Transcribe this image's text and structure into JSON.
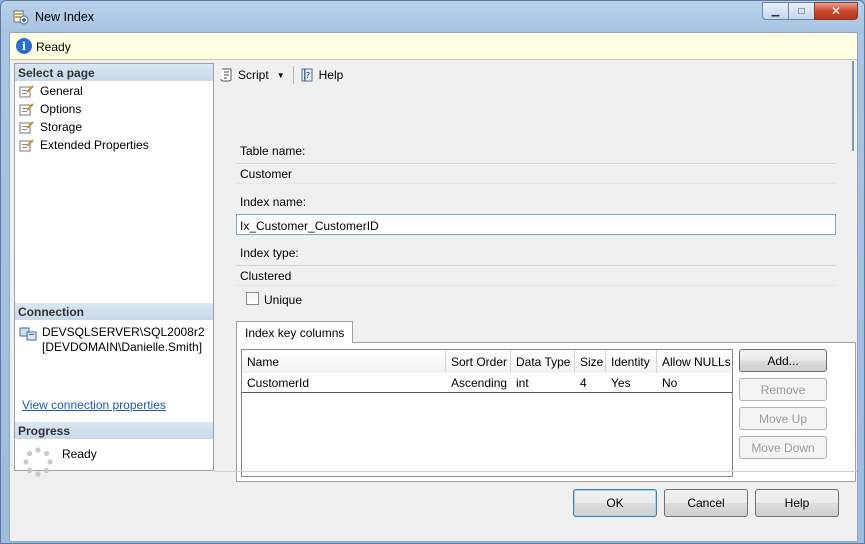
{
  "window": {
    "title": "New Index",
    "buttons": {
      "minimize": "▁",
      "maximize": "□",
      "close": "✕"
    }
  },
  "status": {
    "icon": "info-icon",
    "text": "Ready"
  },
  "sidebar": {
    "select_page_header": "Select a page",
    "pages": [
      "General",
      "Options",
      "Storage",
      "Extended Properties"
    ],
    "connection_header": "Connection",
    "connection_server": "DEVSQLSERVER\\SQL2008r2",
    "connection_user": "[DEVDOMAIN\\Danielle.Smith]",
    "connection_link": "View connection properties",
    "progress_header": "Progress",
    "progress_status": "Ready"
  },
  "toolbar": {
    "script_label": "Script",
    "help_label": "Help"
  },
  "form": {
    "table_name_label": "Table name:",
    "table_name_value": "Customer",
    "index_name_label": "Index name:",
    "index_name_value": "Ix_Customer_CustomerID",
    "index_type_label": "Index type:",
    "index_type_value": "Clustered",
    "unique_label": "Unique",
    "unique_checked": false
  },
  "key_columns": {
    "tab_label": "Index key columns",
    "headers": [
      "Name",
      "Sort Order",
      "Data Type",
      "Size",
      "Identity",
      "Allow NULLs"
    ],
    "rows": [
      [
        "CustomerId",
        "Ascending",
        "int",
        "4",
        "Yes",
        "No"
      ]
    ],
    "buttons": {
      "add": "Add...",
      "remove": "Remove",
      "move_up": "Move Up",
      "move_down": "Move Down"
    }
  },
  "dialog_buttons": {
    "ok": "OK",
    "cancel": "Cancel",
    "help": "Help"
  }
}
